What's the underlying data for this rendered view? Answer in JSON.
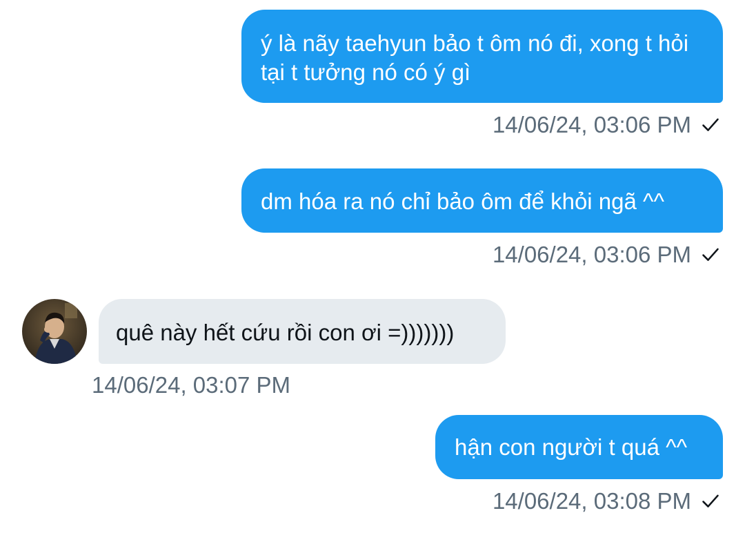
{
  "messages": [
    {
      "direction": "sent",
      "text": "ý là nãy taehyun bảo t ôm nó đi, xong t hỏi tại t tưởng nó có ý gì",
      "timestamp": "14/06/24, 03:06 PM",
      "status_icon": "checkmark-icon"
    },
    {
      "direction": "sent",
      "text": "dm hóa ra nó chỉ bảo ôm để khỏi ngã ^^",
      "timestamp": "14/06/24, 03:06 PM",
      "status_icon": "checkmark-icon"
    },
    {
      "direction": "received",
      "text": "quê này hết cứu rồi con ơi =)))))))",
      "timestamp": "14/06/24, 03:07 PM",
      "avatar": "avatar-icon"
    },
    {
      "direction": "sent",
      "text": "hận con người t quá ^^",
      "timestamp": "14/06/24, 03:08 PM",
      "status_icon": "checkmark-icon"
    }
  ],
  "colors": {
    "sent_bubble": "#1d9bf0",
    "received_bubble": "#e6ebef",
    "timestamp": "#5b6b79"
  }
}
